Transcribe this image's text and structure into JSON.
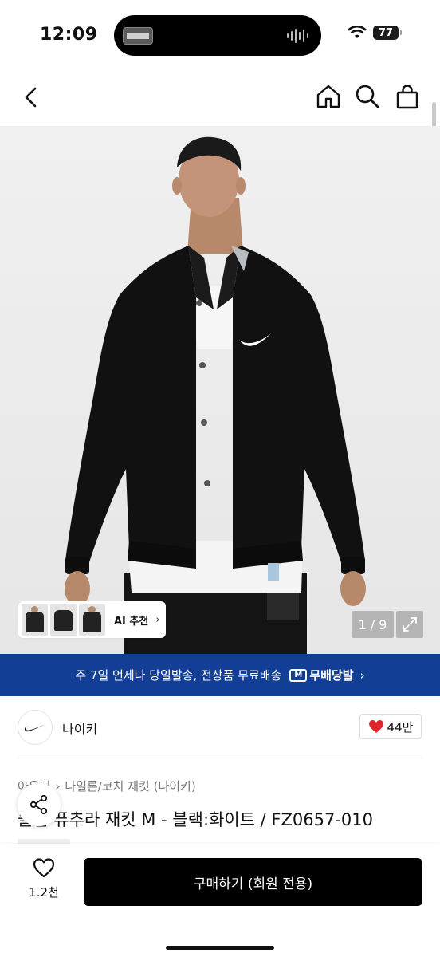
{
  "status": {
    "time": "12:09",
    "battery": "77"
  },
  "nav": {
    "back_icon": "chevron-left-icon",
    "home_icon": "home-icon",
    "search_icon": "search-icon",
    "bag_icon": "shopping-bag-icon"
  },
  "gallery": {
    "ai_label": "AI 추천",
    "page_counter": "1 / 9",
    "thumb_count_text": ""
  },
  "shipping_banner": {
    "text": "주 7일 언제나 당일발송, 전상품 무료배송",
    "logo_letter": "M",
    "logo_text": "무배당발",
    "arrow": "›"
  },
  "brand": {
    "name": "나이키",
    "likes": "44만"
  },
  "product": {
    "breadcrumb": [
      "아우터",
      "나일론/코치 재킷 (나이키)"
    ],
    "title": "클럽 퓨추라 재킷 M - 블랙:화이트 / FZ0657-010"
  },
  "bottom": {
    "wish_count": "1.2천",
    "buy_label": "구매하기 (회원 전용)"
  },
  "colors": {
    "banner": "#123f95",
    "buy_button": "#000000",
    "like_heart": "#e0262b"
  }
}
